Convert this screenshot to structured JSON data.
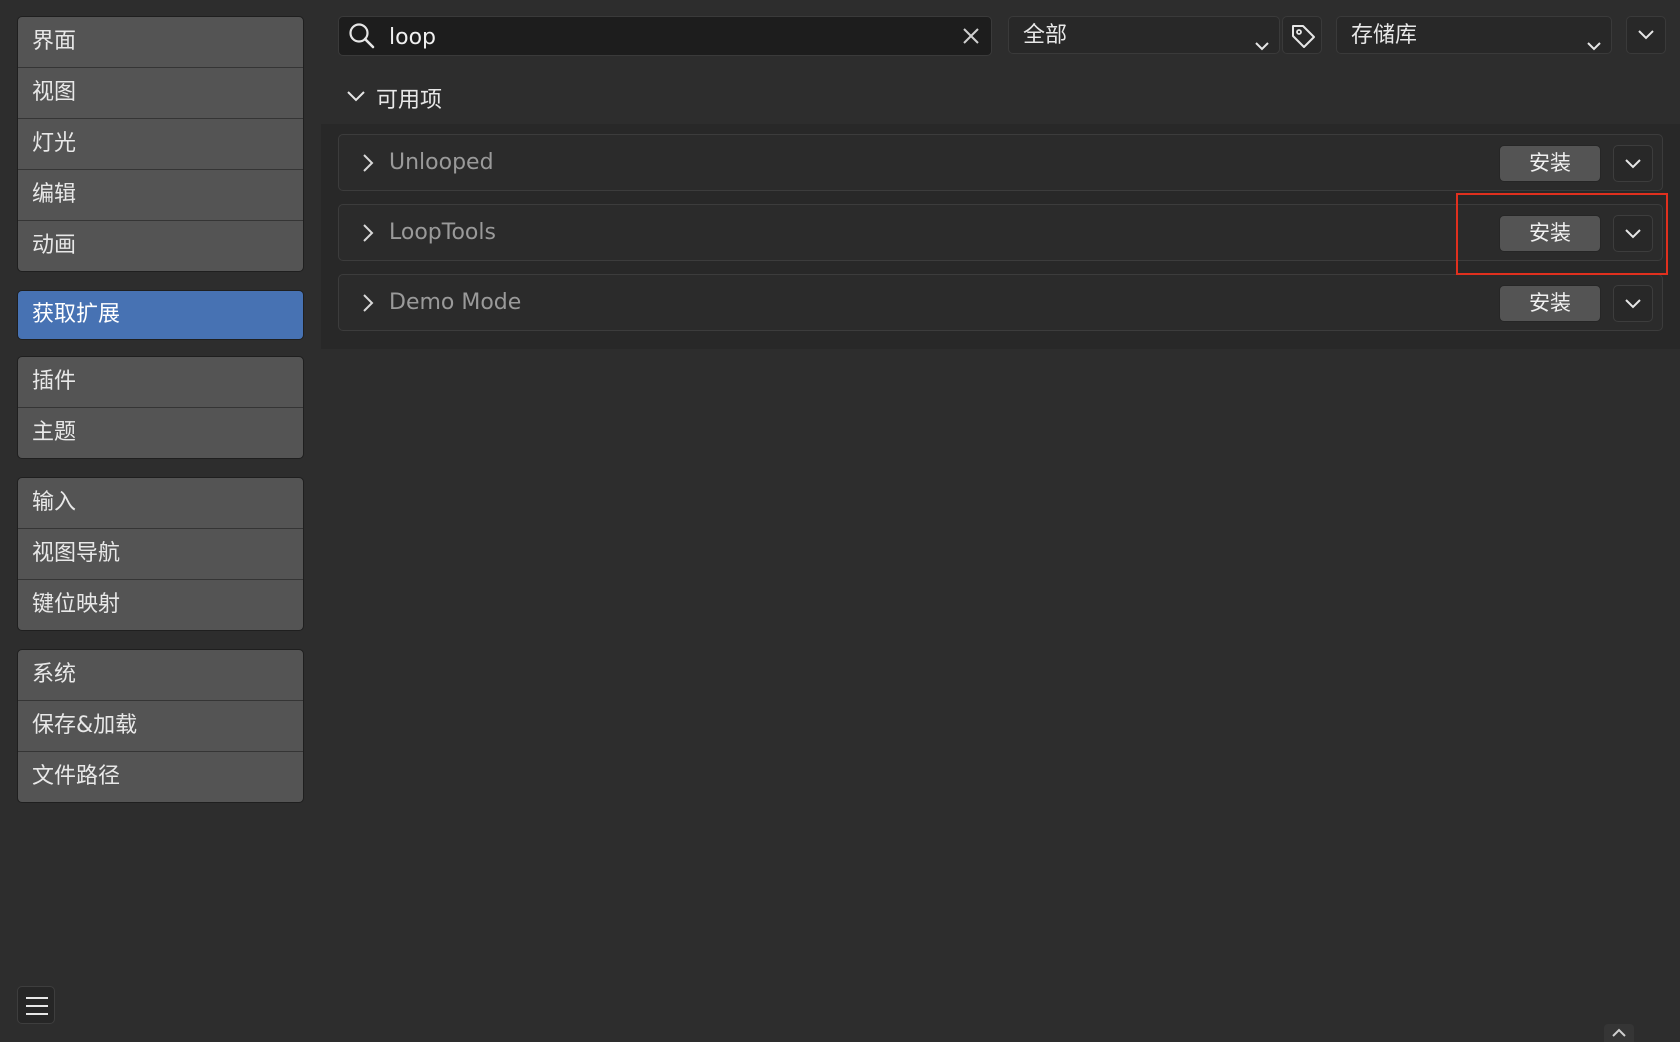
{
  "sidebar": {
    "group1": [
      {
        "label": "界面"
      },
      {
        "label": "视图"
      },
      {
        "label": "灯光"
      },
      {
        "label": "编辑"
      },
      {
        "label": "动画"
      }
    ],
    "active": {
      "label": "获取扩展"
    },
    "group2": [
      {
        "label": "插件"
      },
      {
        "label": "主题"
      }
    ],
    "group3": [
      {
        "label": "输入"
      },
      {
        "label": "视图导航"
      },
      {
        "label": "键位映射"
      }
    ],
    "group4": [
      {
        "label": "系统"
      },
      {
        "label": "保存&加载"
      },
      {
        "label": "文件路径"
      }
    ]
  },
  "search": {
    "value": "loop",
    "icon": "search-icon",
    "clear_icon": "close-icon"
  },
  "filter": {
    "selected": "全部"
  },
  "repository": {
    "selected": "存储库"
  },
  "section": {
    "title": "可用项",
    "expanded": true
  },
  "extensions": [
    {
      "name": "Unlooped",
      "install_label": "安装"
    },
    {
      "name": "LoopTools",
      "install_label": "安装"
    },
    {
      "name": "Demo Mode",
      "install_label": "安装"
    }
  ],
  "colors": {
    "accent": "#4772b3",
    "highlight": "#e0301e",
    "background": "#2d2d2d"
  }
}
